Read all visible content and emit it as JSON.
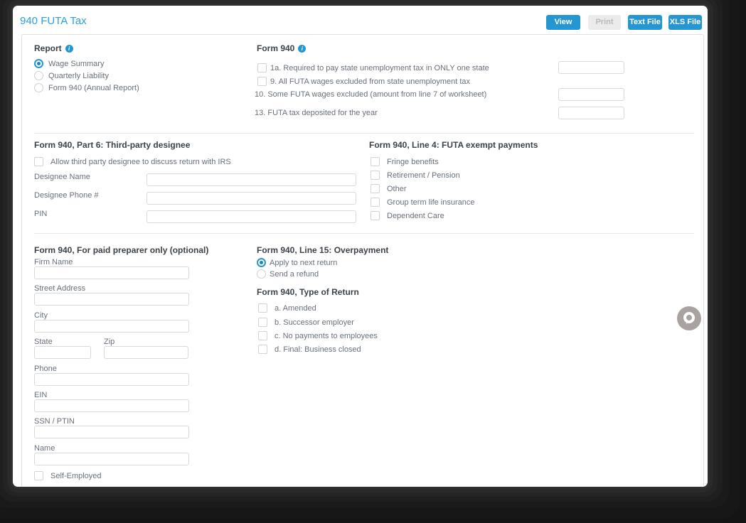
{
  "page": {
    "title": "940 FUTA Tax"
  },
  "toolbar": {
    "view_label": "View",
    "print_label": "Print",
    "print_disabled": true,
    "text_file_label": "Text File",
    "xls_file_label": "XLS File"
  },
  "colors": {
    "accent_blue": "#2596cf",
    "title_blue": "#2d9fd9",
    "heading_text": "#3b4248",
    "label_text": "#68707a",
    "frame_dark": "#1a1a1a"
  },
  "icons": {
    "report_info": "info-icon",
    "form940_info": "info-icon",
    "chat_widget": "chat-bubble-icon"
  },
  "report": {
    "heading": "Report",
    "options": [
      {
        "label": "Wage Summary",
        "selected": true
      },
      {
        "label": "Quarterly Liability",
        "selected": false
      },
      {
        "label": "Form 940 (Annual Report)",
        "selected": false
      }
    ]
  },
  "form940": {
    "heading": "Form 940",
    "line_1a": {
      "label": "1a. Required to pay state unemployment tax in ONLY one state",
      "checked": false,
      "value": ""
    },
    "line_9": {
      "label": "9. All FUTA wages excluded from state unemployment tax",
      "checked": false
    },
    "line_10": {
      "label": "10. Some FUTA wages excluded (amount from line 7 of worksheet)",
      "value": ""
    },
    "line_13": {
      "label": "13. FUTA tax deposited for the year",
      "value": ""
    }
  },
  "part6": {
    "heading": "Form 940, Part 6: Third-party designee",
    "allow_checkbox_label": "Allow third party designee to discuss return with IRS",
    "allow_checked": false,
    "fields": [
      {
        "label": "Designee Name",
        "value": ""
      },
      {
        "label": "Designee Phone #",
        "value": ""
      },
      {
        "label": "PIN",
        "value": ""
      }
    ]
  },
  "line4": {
    "heading": "Form 940, Line 4: FUTA exempt payments",
    "options": [
      {
        "label": "Fringe benefits",
        "checked": false
      },
      {
        "label": "Retirement / Pension",
        "checked": false
      },
      {
        "label": "Other",
        "checked": false
      },
      {
        "label": "Group term life insurance",
        "checked": false
      },
      {
        "label": "Dependent Care",
        "checked": false
      }
    ]
  },
  "preparer": {
    "heading": "Form 940, For paid preparer only (optional)",
    "fields": [
      {
        "label": "Firm Name",
        "value": ""
      },
      {
        "label": "Street Address",
        "value": ""
      },
      {
        "label": "City",
        "value": ""
      },
      {
        "label": "State",
        "value": ""
      },
      {
        "label": "Zip",
        "value": ""
      },
      {
        "label": "Phone",
        "value": ""
      },
      {
        "label": "EIN",
        "value": ""
      },
      {
        "label": "SSN / PTIN",
        "value": ""
      },
      {
        "label": "Name",
        "value": ""
      }
    ],
    "self_employed_label": "Self-Employed",
    "self_employed_checked": false
  },
  "overpayment": {
    "heading": "Form 940, Line 15: Overpayment",
    "options": [
      {
        "label": "Apply to next return",
        "selected": true
      },
      {
        "label": "Send a refund",
        "selected": false
      }
    ]
  },
  "type_of_return": {
    "heading": "Form 940, Type of Return",
    "options": [
      {
        "label": "a. Amended",
        "checked": false
      },
      {
        "label": "b. Successor employer",
        "checked": false
      },
      {
        "label": "c. No payments to employees",
        "checked": false
      },
      {
        "label": "d. Final: Business closed",
        "checked": false
      }
    ]
  }
}
